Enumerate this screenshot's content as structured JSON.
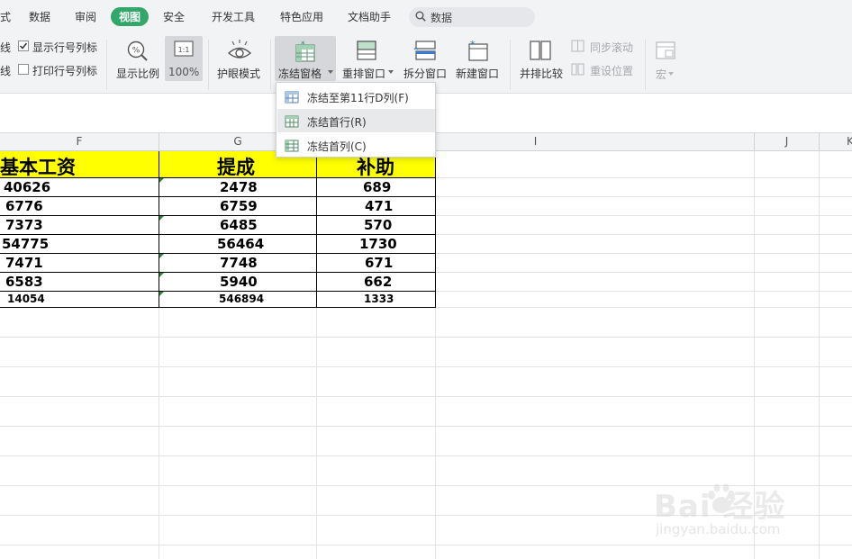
{
  "tabs": [
    {
      "label": "式",
      "active": false
    },
    {
      "label": "数据",
      "active": false
    },
    {
      "label": "审阅",
      "active": false
    },
    {
      "label": "视图",
      "active": true
    },
    {
      "label": "安全",
      "active": false
    },
    {
      "label": "开发工具",
      "active": false
    },
    {
      "label": "特色应用",
      "active": false
    },
    {
      "label": "文档助手",
      "active": false
    }
  ],
  "search": {
    "value": "数据",
    "icon": "search-icon"
  },
  "ribbon": {
    "gridlines_label": "线",
    "print_gridlines_label": "线",
    "show_rowcol_label": "显示行号列标",
    "show_rowcol_checked": true,
    "print_rowcol_label": "打印行号列标",
    "print_rowcol_checked": false,
    "zoom_label": "显示比例",
    "zoom_100_label": "100%",
    "eye_mode_label": "护眼模式",
    "freeze_label": "冻结窗格",
    "rearrange_label": "重排窗口",
    "split_label": "拆分窗口",
    "new_window_label": "新建窗口",
    "side_by_side_label": "并排比较",
    "sync_scroll_label": "同步滚动",
    "reset_position_label": "重设位置",
    "macro_label": "宏"
  },
  "freeze_menu": {
    "items": [
      {
        "label": "冻结至第11行D列(F)",
        "hover": false
      },
      {
        "label": "冻结首行(R)",
        "hover": true
      },
      {
        "label": "冻结首列(C)",
        "hover": false
      }
    ]
  },
  "columns": [
    "F",
    "G",
    "I",
    "J",
    "K"
  ],
  "table": {
    "headers": [
      "基本工资",
      "提成",
      "补助"
    ],
    "header_bg": "#ffff00",
    "rows": [
      [
        "40626",
        "2478",
        "689"
      ],
      [
        "6776",
        "6759",
        "471"
      ],
      [
        "7373",
        "6485",
        "570"
      ],
      [
        "54775",
        "56464",
        "1730"
      ],
      [
        "7471",
        "7748",
        "671"
      ],
      [
        "6583",
        "5940",
        "662"
      ],
      [
        "14054",
        "546894",
        "1333"
      ]
    ]
  },
  "watermark": {
    "main": "Bai 经验",
    "sub": "jingyan.baidu.com"
  },
  "colors": {
    "accent": "#31a86a",
    "ribbon_bg": "#f2f3f5",
    "hover": "#e8e9eb"
  }
}
